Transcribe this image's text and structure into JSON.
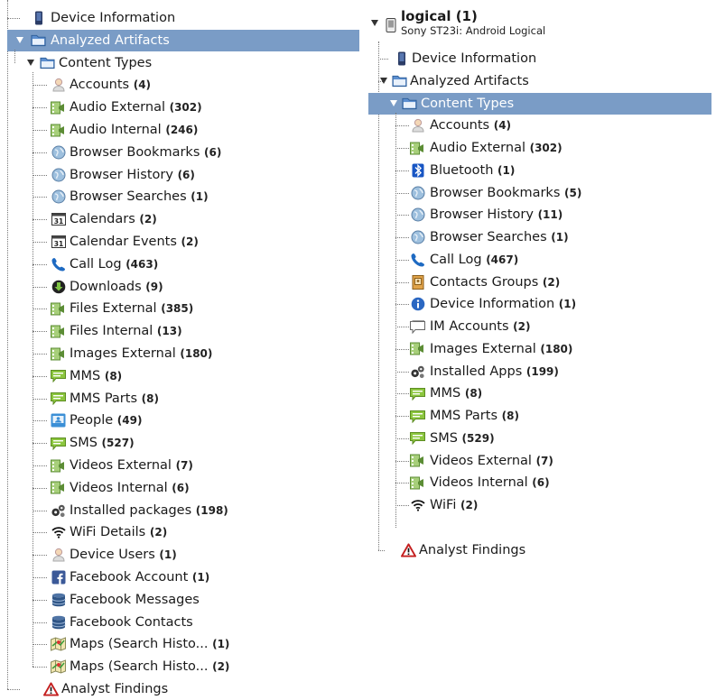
{
  "left_tree": {
    "device_information": "Device Information",
    "analyzed_artifacts": "Analyzed Artifacts",
    "content_types": "Content Types",
    "items": [
      {
        "label": "Accounts",
        "count": "(4)",
        "icon": "person-icon"
      },
      {
        "label": "Audio External",
        "count": "(302)",
        "icon": "media-icon"
      },
      {
        "label": "Audio Internal",
        "count": "(246)",
        "icon": "media-icon"
      },
      {
        "label": "Browser Bookmarks",
        "count": "(6)",
        "icon": "globe-icon"
      },
      {
        "label": "Browser History",
        "count": "(6)",
        "icon": "globe-icon"
      },
      {
        "label": "Browser Searches",
        "count": "(1)",
        "icon": "globe-icon"
      },
      {
        "label": "Calendars",
        "count": "(2)",
        "icon": "calendar-icon"
      },
      {
        "label": "Calendar Events",
        "count": "(2)",
        "icon": "calendar-icon"
      },
      {
        "label": "Call Log",
        "count": "(463)",
        "icon": "phone-icon"
      },
      {
        "label": "Downloads",
        "count": "(9)",
        "icon": "download-icon"
      },
      {
        "label": "Files External",
        "count": "(385)",
        "icon": "media-icon"
      },
      {
        "label": "Files Internal",
        "count": "(13)",
        "icon": "media-icon"
      },
      {
        "label": "Images External",
        "count": "(180)",
        "icon": "media-icon"
      },
      {
        "label": "MMS",
        "count": "(8)",
        "icon": "message-icon"
      },
      {
        "label": "MMS Parts",
        "count": "(8)",
        "icon": "message-icon"
      },
      {
        "label": "People",
        "count": "(49)",
        "icon": "contact-card-icon"
      },
      {
        "label": "SMS",
        "count": "(527)",
        "icon": "message-icon"
      },
      {
        "label": "Videos External",
        "count": "(7)",
        "icon": "media-icon"
      },
      {
        "label": "Videos Internal",
        "count": "(6)",
        "icon": "media-icon"
      },
      {
        "label": "Installed packages",
        "count": "(198)",
        "icon": "gears-icon"
      },
      {
        "label": "WiFi Details",
        "count": "(2)",
        "icon": "wifi-icon"
      },
      {
        "label": "Device Users",
        "count": "(1)",
        "icon": "person-icon"
      },
      {
        "label": "Facebook Account",
        "count": "(1)",
        "icon": "facebook-icon"
      },
      {
        "label": "Facebook Messages",
        "count": "",
        "icon": "database-icon"
      },
      {
        "label": "Facebook Contacts",
        "count": "",
        "icon": "database-icon"
      },
      {
        "label": "Maps (Search Histo...",
        "count": "(1)",
        "icon": "map-icon"
      },
      {
        "label": "Maps (Search Histo...",
        "count": "(2)",
        "icon": "map-icon"
      }
    ],
    "analyst_findings": "Analyst Findings"
  },
  "right_tree": {
    "device_title": "logical (1)",
    "device_subtitle": "Sony ST23i: Android Logical",
    "device_information": "Device Information",
    "analyzed_artifacts": "Analyzed Artifacts",
    "content_types": "Content Types",
    "items": [
      {
        "label": "Accounts",
        "count": "(4)",
        "icon": "person-icon"
      },
      {
        "label": "Audio External",
        "count": "(302)",
        "icon": "media-icon"
      },
      {
        "label": "Bluetooth",
        "count": "(1)",
        "icon": "bluetooth-icon"
      },
      {
        "label": "Browser Bookmarks",
        "count": "(5)",
        "icon": "globe-icon"
      },
      {
        "label": "Browser History",
        "count": "(11)",
        "icon": "globe-icon"
      },
      {
        "label": "Browser Searches",
        "count": "(1)",
        "icon": "globe-icon"
      },
      {
        "label": "Call Log",
        "count": "(467)",
        "icon": "phone-icon"
      },
      {
        "label": "Contacts Groups",
        "count": "(2)",
        "icon": "contacts-book-icon"
      },
      {
        "label": "Device Information",
        "count": "(1)",
        "icon": "info-icon"
      },
      {
        "label": "IM Accounts",
        "count": "(2)",
        "icon": "chat-bubble-icon"
      },
      {
        "label": "Images External",
        "count": "(180)",
        "icon": "media-icon"
      },
      {
        "label": "Installed Apps",
        "count": "(199)",
        "icon": "gears-icon"
      },
      {
        "label": "MMS",
        "count": "(8)",
        "icon": "message-icon"
      },
      {
        "label": "MMS Parts",
        "count": "(8)",
        "icon": "message-icon"
      },
      {
        "label": "SMS",
        "count": "(529)",
        "icon": "message-icon"
      },
      {
        "label": "Videos External",
        "count": "(7)",
        "icon": "media-icon"
      },
      {
        "label": "Videos Internal",
        "count": "(6)",
        "icon": "media-icon"
      },
      {
        "label": "WiFi",
        "count": "(2)",
        "icon": "wifi-icon"
      }
    ],
    "analyst_findings": "Analyst Findings"
  },
  "colors": {
    "selection": "#7a9cc6",
    "folder": "#3d7fc4",
    "message_green": "#8cc63f",
    "facebook": "#3b5998",
    "warning_red": "#cc1f1f"
  }
}
